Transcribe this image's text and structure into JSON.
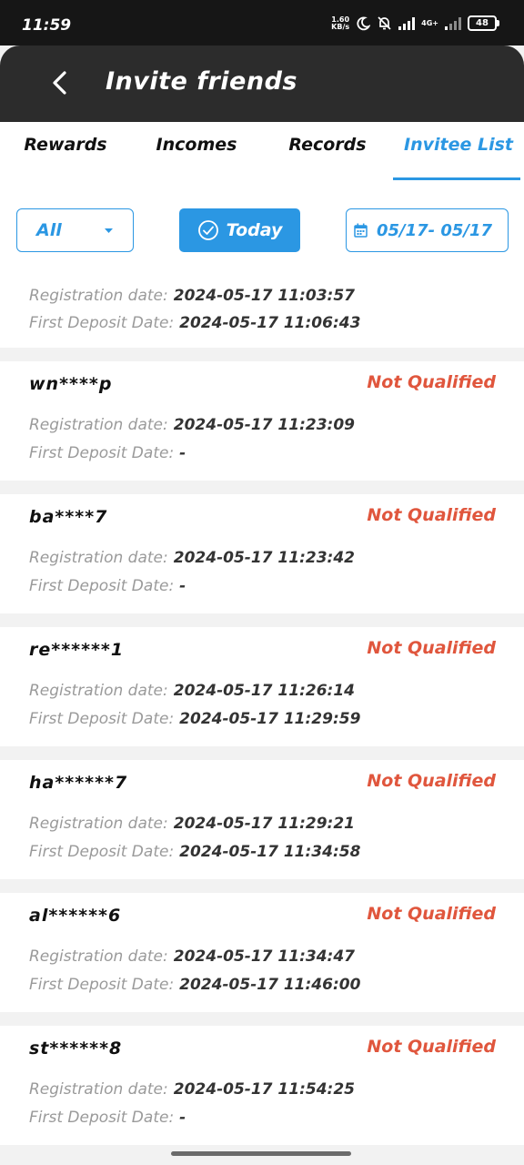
{
  "status_bar": {
    "time": "11:59",
    "net_speed_value": "1.60",
    "net_speed_unit": "KB/s",
    "network": "4G+",
    "battery": "48"
  },
  "app_bar": {
    "title": "Invite friends",
    "back_icon": "chevron-left-icon"
  },
  "tabs": [
    {
      "label": "Rewards",
      "active": false
    },
    {
      "label": "Incomes",
      "active": false
    },
    {
      "label": "Records",
      "active": false
    },
    {
      "label": "Invitee List",
      "active": true
    }
  ],
  "filters": {
    "dropdown_value": "All",
    "today_label": "Today",
    "date_range": "05/17- 05/17"
  },
  "labels": {
    "registration": "Registration date:",
    "first_deposit": "First Deposit Date:"
  },
  "invitees": [
    {
      "user": "",
      "status": "",
      "registration": "2024-05-17 11:03:57",
      "first_deposit": "2024-05-17 11:06:43"
    },
    {
      "user": "wn****p",
      "status": "Not Qualified",
      "registration": "2024-05-17 11:23:09",
      "first_deposit": "-"
    },
    {
      "user": "ba****7",
      "status": "Not Qualified",
      "registration": "2024-05-17 11:23:42",
      "first_deposit": "-"
    },
    {
      "user": "re******1",
      "status": "Not Qualified",
      "registration": "2024-05-17 11:26:14",
      "first_deposit": "2024-05-17 11:29:59"
    },
    {
      "user": "ha******7",
      "status": "Not Qualified",
      "registration": "2024-05-17 11:29:21",
      "first_deposit": "2024-05-17 11:34:58"
    },
    {
      "user": "al******6",
      "status": "Not Qualified",
      "registration": "2024-05-17 11:34:47",
      "first_deposit": "2024-05-17 11:46:00"
    },
    {
      "user": "st******8",
      "status": "Not Qualified",
      "registration": "2024-05-17 11:54:25",
      "first_deposit": "-"
    }
  ],
  "colors": {
    "accent": "#2b97e3",
    "not_qualified": "#e0563d",
    "app_bar": "#2c2c2c",
    "status_bar": "#161616"
  }
}
